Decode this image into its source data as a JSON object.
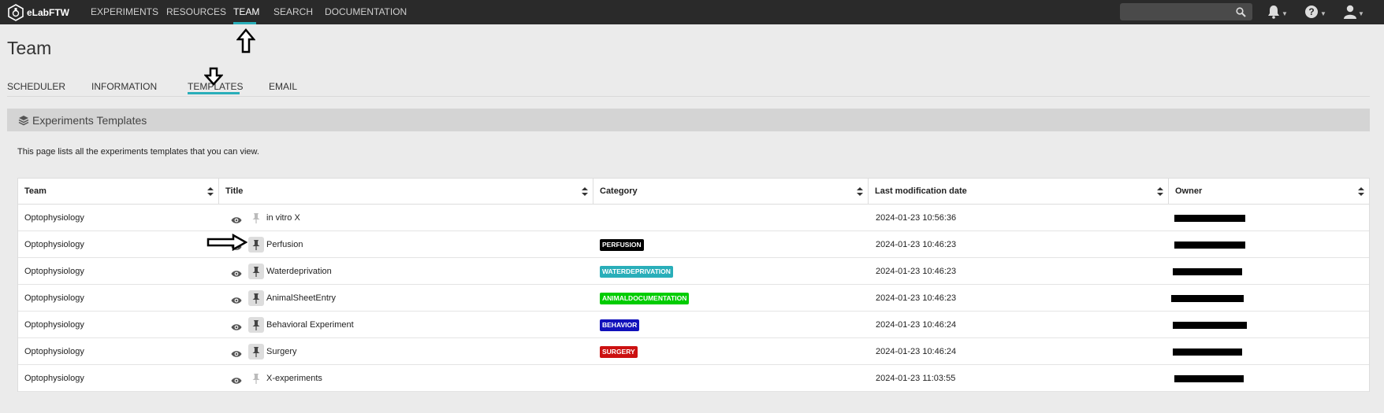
{
  "app": {
    "name": "eLabFTW"
  },
  "nav": {
    "items": [
      {
        "label": "EXPERIMENTS"
      },
      {
        "label": "RESOURCES"
      },
      {
        "label": "TEAM"
      },
      {
        "label": "SEARCH"
      },
      {
        "label": "DOCUMENTATION"
      }
    ],
    "active": "TEAM",
    "search_placeholder": ""
  },
  "page": {
    "title": "Team"
  },
  "tabs": [
    {
      "label": "SCHEDULER"
    },
    {
      "label": "INFORMATION"
    },
    {
      "label": "TEMPLATES"
    },
    {
      "label": "EMAIL"
    }
  ],
  "active_tab": "TEMPLATES",
  "section": {
    "title": "Experiments Templates",
    "intro": "This page lists all the experiments templates that you can view."
  },
  "table": {
    "headers": [
      "Team",
      "Title",
      "Category",
      "Last modification date",
      "Owner"
    ],
    "rows": [
      {
        "team": "Optophysiology",
        "title": "in vitro X",
        "category": "",
        "category_color": "",
        "date": "2024-01-23 10:56:36",
        "pinned": false
      },
      {
        "team": "Optophysiology",
        "title": "Perfusion",
        "category": "PERFUSION",
        "category_color": "#000000",
        "date": "2024-01-23 10:46:23",
        "pinned": true
      },
      {
        "team": "Optophysiology",
        "title": "Waterdeprivation",
        "category": "WATERDEPRIVATION",
        "category_color": "#29aeb9",
        "date": "2024-01-23 10:46:23",
        "pinned": true
      },
      {
        "team": "Optophysiology",
        "title": "AnimalSheetEntry",
        "category": "ANIMALDOCUMENTATION",
        "category_color": "#00cc00",
        "date": "2024-01-23 10:46:23",
        "pinned": true
      },
      {
        "team": "Optophysiology",
        "title": "Behavioral Experiment",
        "category": "BEHAVIOR",
        "category_color": "#1111bb",
        "date": "2024-01-23 10:46:24",
        "pinned": true
      },
      {
        "team": "Optophysiology",
        "title": "Surgery",
        "category": "SURGERY",
        "category_color": "#cc1111",
        "date": "2024-01-23 10:46:24",
        "pinned": true
      },
      {
        "team": "Optophysiology",
        "title": "X-experiments",
        "category": "",
        "category_color": "",
        "date": "2024-01-23 11:03:55",
        "pinned": false
      }
    ]
  },
  "icons": {
    "logo": "elabftw-logo-icon",
    "search": "search-icon",
    "bell": "bell-icon",
    "help": "help-icon",
    "user": "user-icon",
    "layers": "layers-icon",
    "sort": "sort-icon",
    "eye": "eye-icon",
    "pin": "pin-icon",
    "annotation": "arrow-annotation-icon"
  },
  "colors": {
    "topbar": "#2a2a2a",
    "accent": "#29aeb9",
    "background": "#ebebeb"
  }
}
